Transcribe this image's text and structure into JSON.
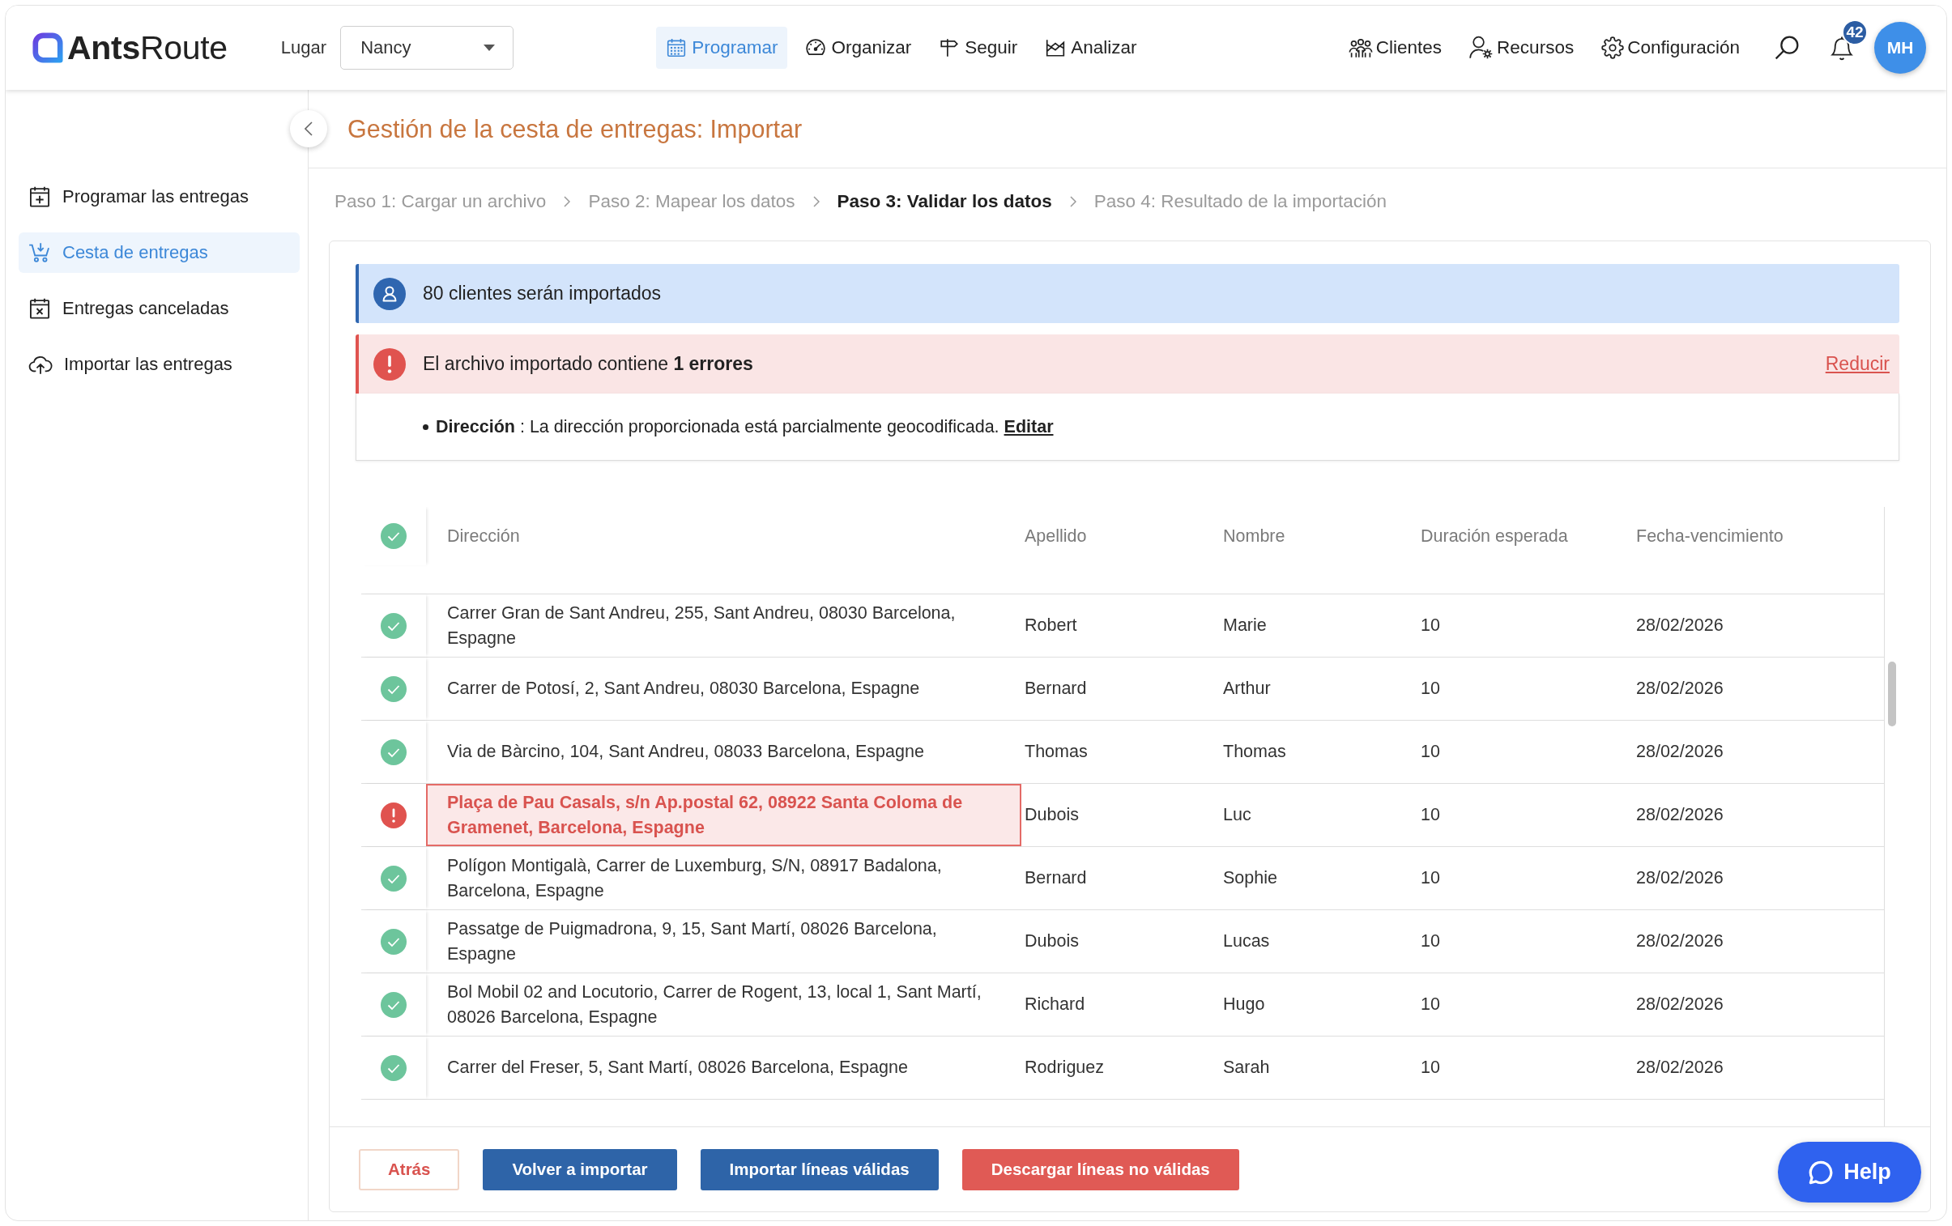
{
  "app_bar": {
    "logo": "**Ants**Route",
    "location": {
      "label": "Lugar",
      "value": "Nancy"
    },
    "nav": [
      {
        "label": "Programar",
        "selected": true
      },
      {
        "label": "Organizar",
        "selected": false
      },
      {
        "label": "Seguir",
        "selected": false
      },
      {
        "label": "Analizar",
        "selected": false
      }
    ],
    "links": [
      "Clientes",
      "Recursos",
      "Configuración"
    ],
    "notifications": "42",
    "avatar": "MH"
  },
  "sidebar": {
    "items": [
      {
        "label": "Programar las entregas",
        "selected": false
      },
      {
        "label": "Cesta de entregas",
        "selected": true
      },
      {
        "label": "Entregas canceladas",
        "selected": false
      },
      {
        "label": "Importar las entregas",
        "selected": false
      }
    ]
  },
  "page": {
    "title": "Gestión de la cesta de entregas: Importar",
    "steps": [
      {
        "label": "Paso 1: Cargar un archivo",
        "selected": false
      },
      {
        "label": "Paso 2: Mapear los datos",
        "selected": false
      },
      {
        "label": "Paso 3: Validar los datos",
        "selected": true
      },
      {
        "label": "Paso 4: Resultado de la importación",
        "selected": false
      }
    ]
  },
  "info_banner": {
    "text": "80 clientes serán importados"
  },
  "error_banner": {
    "text": "El archivo importado contiene **1 errores**",
    "action": "Reducir",
    "details": [
      {
        "text": "**Dirección** : La dirección proporcionada está parcialmente geocodificada.",
        "link": "Editar"
      }
    ]
  },
  "table": {
    "columns": [
      "Dirección",
      "Apellido",
      "Nombre",
      "Duración esperada",
      "Fecha-vencimiento"
    ],
    "rows": [
      {
        "valid": true,
        "cells": [
          "Carrer Gran de Sant Andreu, 255, Sant Andreu, 08030 Barcelona, Espagne",
          "Robert",
          "Marie",
          "10",
          "28/02/2026"
        ]
      },
      {
        "valid": true,
        "cells": [
          "Carrer de Potosí, 2, Sant Andreu, 08030 Barcelona, Espagne",
          "Bernard",
          "Arthur",
          "10",
          "28/02/2026"
        ]
      },
      {
        "valid": true,
        "cells": [
          "Via de Bàrcino, 104, Sant Andreu, 08033 Barcelona, Espagne",
          "Thomas",
          "Thomas",
          "10",
          "28/02/2026"
        ]
      },
      {
        "valid": false,
        "cells": [
          "Plaça de Pau Casals, s/n Ap.postal 62, 08922 Santa Coloma de Gramenet, Barcelona, Espagne",
          "Dubois",
          "Luc",
          "10",
          "28/02/2026"
        ]
      },
      {
        "valid": true,
        "cells": [
          "Polígon Montigalà, Carrer de Luxemburg, S/N, 08917 Badalona, Barcelona, Espagne",
          "Bernard",
          "Sophie",
          "10",
          "28/02/2026"
        ]
      },
      {
        "valid": true,
        "cells": [
          "Passatge de Puigmadrona, 9, 15, Sant Martí, 08026 Barcelona, Espagne",
          "Dubois",
          "Lucas",
          "10",
          "28/02/2026"
        ]
      },
      {
        "valid": true,
        "cells": [
          "Bol Mobil 02 and Locutorio, Carrer de Rogent, 13, local 1, Sant Martí, 08026 Barcelona, Espagne",
          "Richard",
          "Hugo",
          "10",
          "28/02/2026"
        ]
      },
      {
        "valid": true,
        "cells": [
          "Carrer del Freser, 5, Sant Martí, 08026 Barcelona, Espagne",
          "Rodriguez",
          "Sarah",
          "10",
          "28/02/2026"
        ]
      }
    ]
  },
  "buttons": [
    {
      "label": "Atrás",
      "kind": "outline"
    },
    {
      "label": "Volver a importar",
      "kind": "primary"
    },
    {
      "label": "Importar líneas válidas",
      "kind": "primary"
    },
    {
      "label": "Descargar líneas no válidas",
      "kind": "danger"
    }
  ],
  "help": {
    "label": "Help"
  }
}
